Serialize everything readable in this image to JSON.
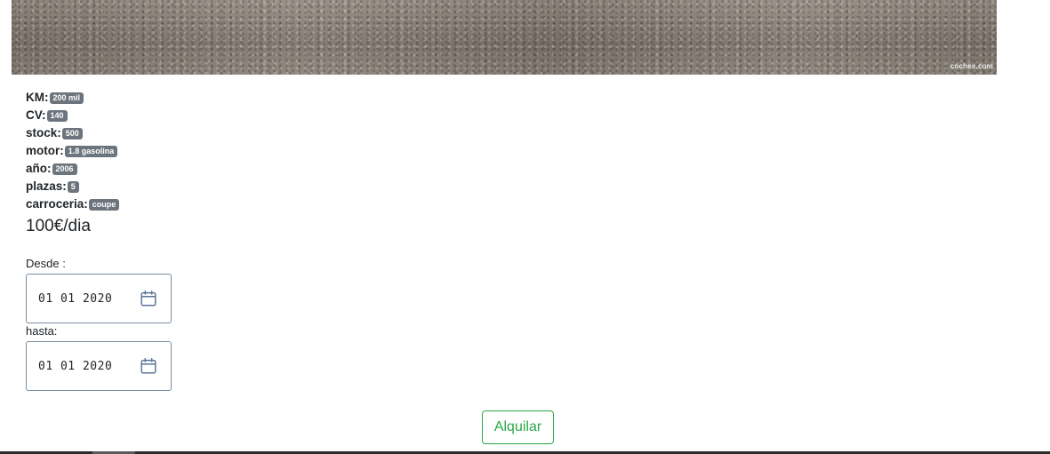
{
  "hero": {
    "watermark": "coches.com"
  },
  "specs": [
    {
      "label": "KM:",
      "value": "200 mil"
    },
    {
      "label": "CV:",
      "value": "140"
    },
    {
      "label": "stock:",
      "value": "500"
    },
    {
      "label": "motor:",
      "value": "1.8 gasolina"
    },
    {
      "label": "año:",
      "value": "2006"
    },
    {
      "label": "plazas:",
      "value": "5"
    },
    {
      "label": "carroceria:",
      "value": "coupe"
    }
  ],
  "price": "100€/dia",
  "form": {
    "desde": {
      "label": "Desde :",
      "value": "01 01 2020"
    },
    "hasta": {
      "label": "hasta:",
      "value": "01 01 2020"
    },
    "submit_label": "Alquilar"
  },
  "colors": {
    "badge": "#6c757d",
    "button": "#28a745",
    "field_border": "#7a8da3",
    "calendar_icon": "#5a7596"
  },
  "icons": {
    "calendar": "calendar-icon"
  }
}
